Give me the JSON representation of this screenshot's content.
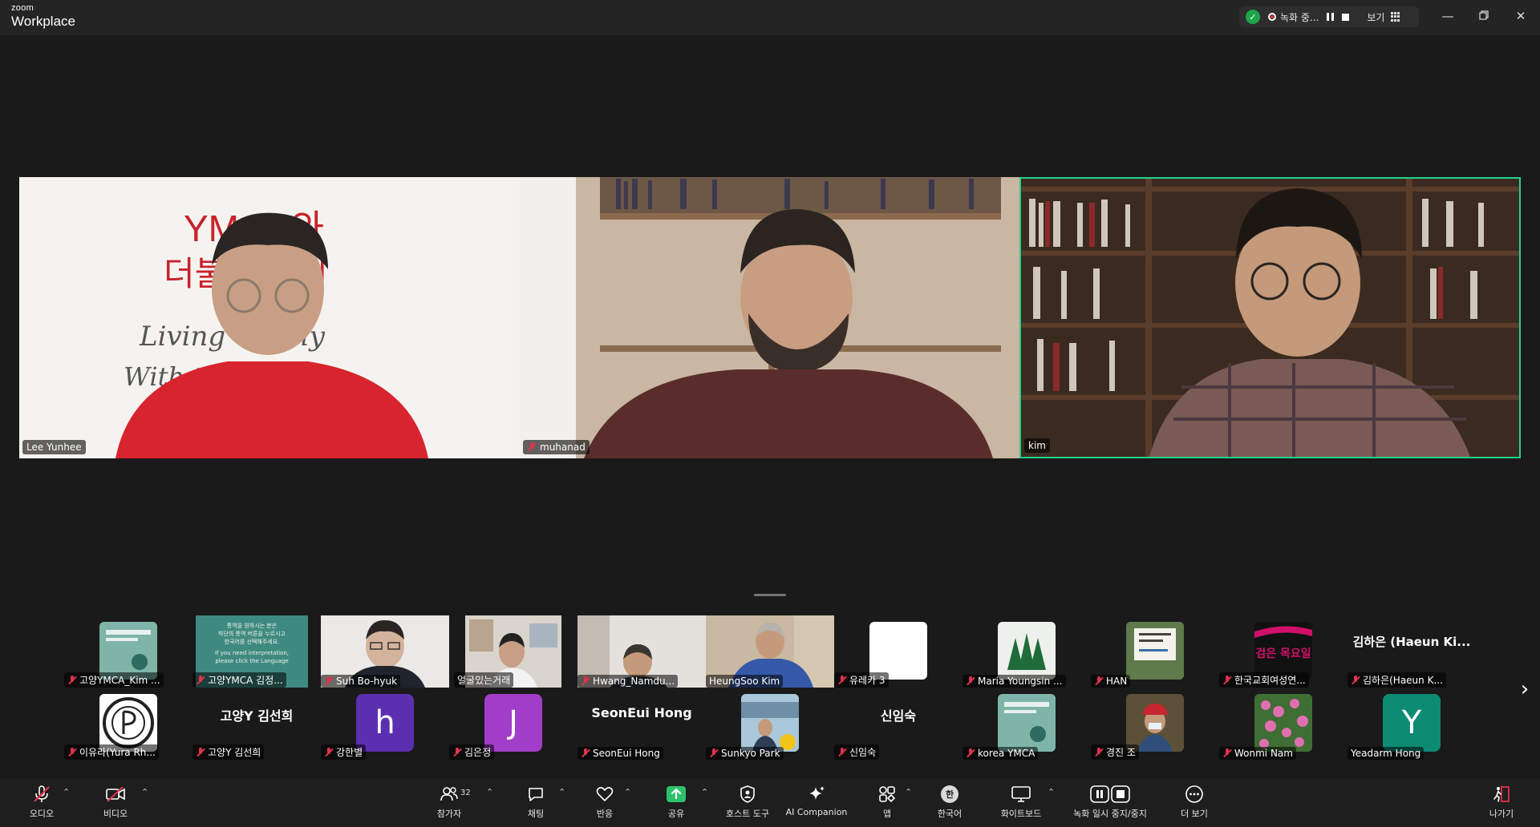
{
  "app": {
    "brand_small": "zoom",
    "brand_large": "Workplace"
  },
  "titlebar": {
    "recording_label": "녹화 중...",
    "view_label": "보기"
  },
  "colors": {
    "active_speaker": "#23d18b",
    "muted": "#e0334c",
    "share": "#2ec16b",
    "leave": "#e0334c"
  },
  "main_tiles": [
    {
      "name": "Lee Yunhee",
      "muted": false,
      "sign_text": [
        "YMCA와",
        "더불어 살기",
        "Living Gently",
        "With the YMCA"
      ]
    },
    {
      "name": "muhanad",
      "muted": true
    },
    {
      "name": "kim",
      "muted": false,
      "active_speaker": true
    }
  ],
  "gallery_row1": [
    {
      "name": "고양YMCA_Kim ...",
      "muted": true,
      "kind": "image"
    },
    {
      "name": "고양YMCA 김정...",
      "muted": true,
      "kind": "image",
      "screen_text": [
        "통역을 원하시는 분은",
        "하단의 통역 버튼을 누르시고",
        "한국어를 선택해주세요.",
        "If you need interpretation,",
        "please click the Language"
      ]
    },
    {
      "name": "Suh Bo-hyuk",
      "muted": true,
      "kind": "video"
    },
    {
      "name": "얼굴있는거래",
      "muted": false,
      "kind": "video"
    },
    {
      "name": "Hwang_Namdu...",
      "muted": true,
      "kind": "video"
    },
    {
      "name": "HeungSoo Kim",
      "muted": false,
      "kind": "video"
    },
    {
      "name": "유레카 3",
      "muted": true,
      "kind": "image"
    },
    {
      "name": "Maria Youngsin ...",
      "muted": true,
      "kind": "image"
    },
    {
      "name": "HAN",
      "muted": true,
      "kind": "image"
    },
    {
      "name": "한국교회여성연...",
      "muted": true,
      "kind": "image",
      "image_text": "검은 목요일"
    },
    {
      "name": "김하은(Haeun K...",
      "muted": true,
      "kind": "text",
      "display_text": "김하은 (Haeun  Ki..."
    }
  ],
  "gallery_row2": [
    {
      "name": "이유라(Yura Rh...",
      "muted": true,
      "kind": "image"
    },
    {
      "name": "고양Y 김선희",
      "muted": true,
      "kind": "text",
      "display_text": "고양Y 김선희"
    },
    {
      "name": "강한별",
      "muted": true,
      "kind": "letter",
      "letter": "h",
      "color": "#5b2fb0"
    },
    {
      "name": "김은정",
      "muted": true,
      "kind": "letter",
      "letter": "J",
      "color": "#a23dc9"
    },
    {
      "name": "SeonEui Hong",
      "muted": true,
      "kind": "text",
      "display_text": "SeonEui Hong"
    },
    {
      "name": "Sunkyo Park",
      "muted": true,
      "kind": "image"
    },
    {
      "name": "신임숙",
      "muted": true,
      "kind": "text",
      "display_text": "신임숙"
    },
    {
      "name": "korea YMCA",
      "muted": true,
      "kind": "image"
    },
    {
      "name": "경진 조",
      "muted": true,
      "kind": "image"
    },
    {
      "name": "Wonmi Nam",
      "muted": true,
      "kind": "image"
    },
    {
      "name": "Yeadarm Hong",
      "muted": false,
      "kind": "letter",
      "letter": "Y",
      "color": "#0d8b73"
    }
  ],
  "toolbar": {
    "audio": "오디오",
    "video": "비디오",
    "participants": "참가자",
    "participants_count": "32",
    "chat": "채팅",
    "reactions": "반응",
    "share": "공유",
    "host_tools": "호스트 도구",
    "ai_companion": "AI Companion",
    "apps": "앱",
    "language": "한국어",
    "language_badge": "한",
    "whiteboard": "화이트보드",
    "recording": "녹화 일시 중지/중지",
    "more": "더 보기",
    "leave": "나가기"
  }
}
